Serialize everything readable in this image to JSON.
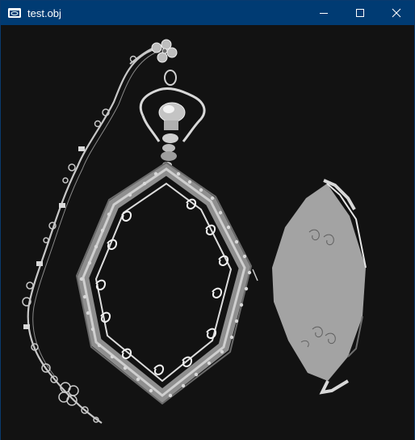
{
  "window": {
    "title": "test.obj",
    "controls": {
      "minimize_icon": "minimize-icon",
      "maximize_icon": "maximize-icon",
      "close_icon": "close-icon"
    }
  },
  "viewport": {
    "background": "#121212",
    "objects": [
      {
        "id": "chain",
        "icon": "necklace-chain"
      },
      {
        "id": "bail",
        "icon": "pendant-bail"
      },
      {
        "id": "frame",
        "icon": "ornate-frame"
      },
      {
        "id": "back-plate",
        "icon": "pendant-back-plate"
      }
    ]
  },
  "colors": {
    "titlebar": "#003b73",
    "mesh_light": "#cfcfcf",
    "mesh_mid": "#9a9a9a",
    "mesh_dark": "#5a5a5a"
  }
}
